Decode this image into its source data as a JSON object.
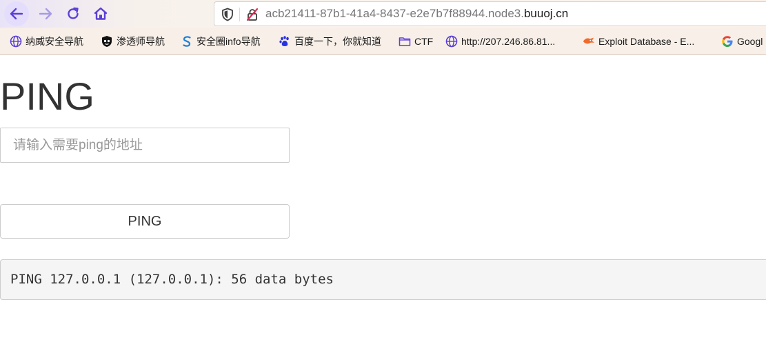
{
  "browser": {
    "url_main": "acb21411-87b1-41a4-8437-e2e7b7f88944.node3.",
    "url_domain": "buuoj.cn",
    "nav_icons": [
      "back-arrow-icon",
      "forward-arrow-icon",
      "reload-icon",
      "home-icon"
    ],
    "accent_color": "#5b3fd8"
  },
  "bookmarks": [
    {
      "label": "纳威安全导航",
      "icon": "globe-icon"
    },
    {
      "label": "渗透师导航",
      "icon": "shield-mask-icon"
    },
    {
      "label": "安全圈info导航",
      "icon": "s-logo-icon"
    },
    {
      "label": "百度一下，你就知道",
      "icon": "baidu-paw-icon"
    },
    {
      "label": "CTF",
      "icon": "folder-icon"
    },
    {
      "label": "http://207.246.86.81...",
      "icon": "globe-icon"
    },
    {
      "label": "Exploit Database - E...",
      "icon": "exploit-db-icon"
    },
    {
      "label": "Googl",
      "icon": "google-icon"
    }
  ],
  "page": {
    "title": "PING",
    "input_placeholder": "请输入需要ping的地址",
    "button_label": "PING",
    "output": "PING 127.0.0.1 (127.0.0.1): 56 data bytes"
  }
}
